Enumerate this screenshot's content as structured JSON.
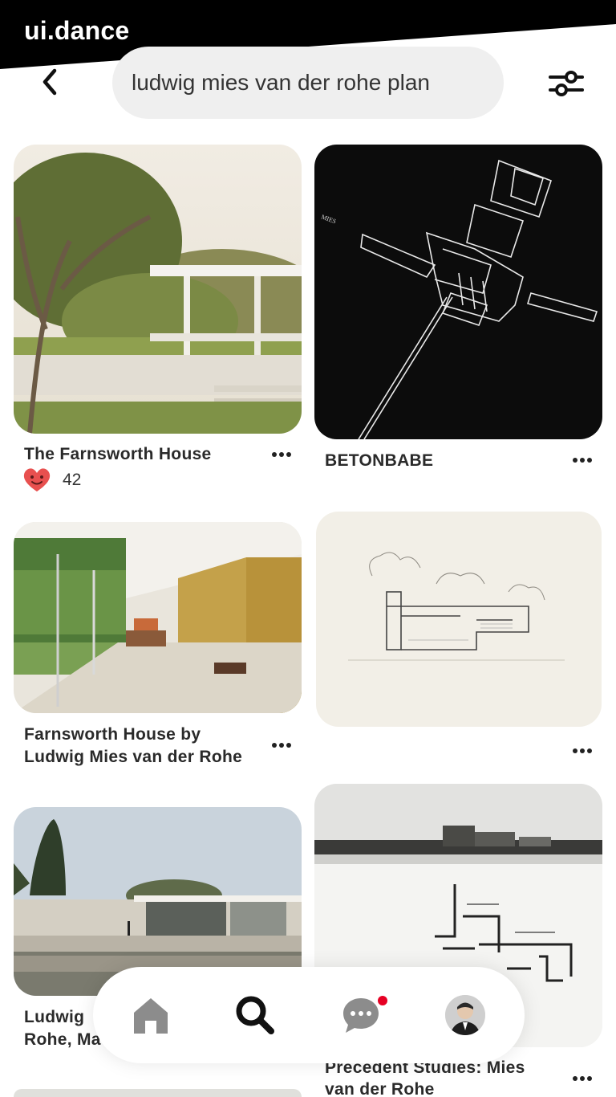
{
  "brand": {
    "watermark": "ui.dance"
  },
  "search": {
    "query": "ludwig mies van der rohe plan"
  },
  "colors": {
    "brand_bar": "#000000",
    "search_bg": "#efefef",
    "notification": "#e60023",
    "heart": "#e8504f"
  },
  "icons": {
    "back": "chevron-left-icon",
    "filter": "sliders-icon",
    "more": "more-dots-icon",
    "heart": "heart-face-icon",
    "home": "home-icon",
    "search": "search-icon",
    "messages": "chat-bubble-icon",
    "profile": "avatar"
  },
  "pins": [
    {
      "title": "The Farnsworth House",
      "likes": "42"
    },
    {
      "title": "BETONBABE"
    },
    {
      "title_line1": "Farnsworth House by",
      "title_line2": "Ludwig Mies van der Rohe"
    },
    {
      "title": ""
    },
    {
      "title_line1": "Ludwig",
      "title_line2": "Rohe, Ma"
    },
    {
      "title_line1": "Precedent Studies: Mies",
      "title_line2": "van der Rohe"
    }
  ],
  "nav": {
    "active": "search",
    "has_notification": true
  }
}
